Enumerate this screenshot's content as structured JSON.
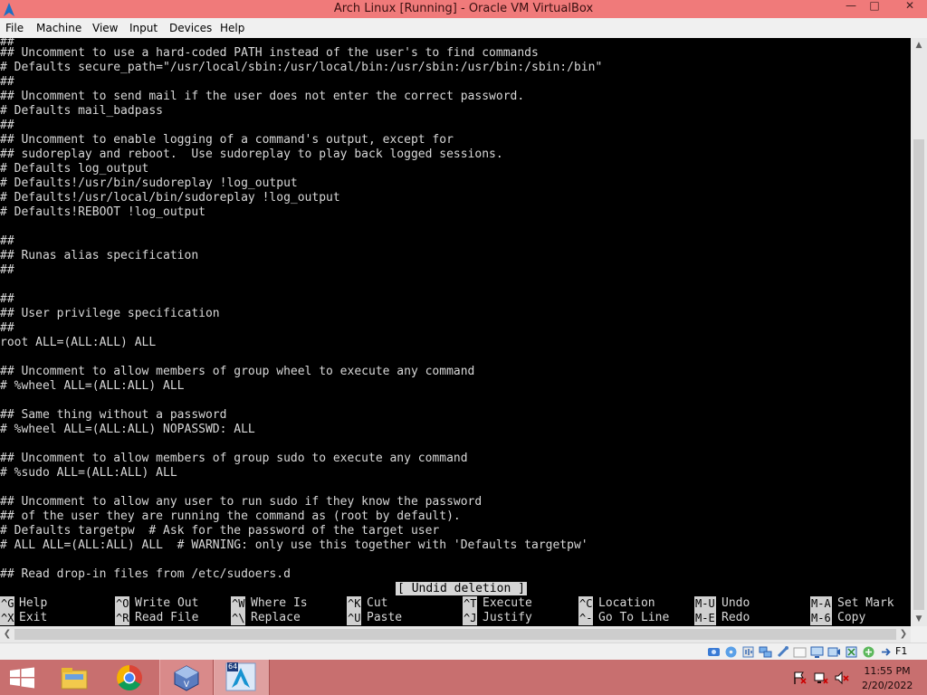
{
  "window": {
    "title": "Arch Linux [Running] - Oracle VM VirtualBox"
  },
  "menu": [
    "File",
    "Machine",
    "View",
    "Input",
    "Devices",
    "Help"
  ],
  "terminal": {
    "lines": [
      "##",
      "## Uncomment to use a hard-coded PATH instead of the user's to find commands",
      "# Defaults secure_path=\"/usr/local/sbin:/usr/local/bin:/usr/sbin:/usr/bin:/sbin:/bin\"",
      "##",
      "## Uncomment to send mail if the user does not enter the correct password.",
      "# Defaults mail_badpass",
      "##",
      "## Uncomment to enable logging of a command's output, except for",
      "## sudoreplay and reboot.  Use sudoreplay to play back logged sessions.",
      "# Defaults log_output",
      "# Defaults!/usr/bin/sudoreplay !log_output",
      "# Defaults!/usr/local/bin/sudoreplay !log_output",
      "# Defaults!REBOOT !log_output",
      "",
      "##",
      "## Runas alias specification",
      "##",
      "",
      "##",
      "## User privilege specification",
      "##",
      "root ALL=(ALL:ALL) ALL",
      "",
      "## Uncomment to allow members of group wheel to execute any command",
      "# %wheel ALL=(ALL:ALL) ALL",
      "",
      "## Same thing without a password",
      "# %wheel ALL=(ALL:ALL) NOPASSWD: ALL",
      "",
      "## Uncomment to allow members of group sudo to execute any command",
      "# %sudo ALL=(ALL:ALL) ALL",
      "",
      "## Uncomment to allow any user to run sudo if they know the password",
      "## of the user they are running the command as (root by default).",
      "# Defaults targetpw  # Ask for the password of the target user",
      "# ALL ALL=(ALL:ALL) ALL  # WARNING: only use this together with 'Defaults targetpw'",
      "",
      "## Read drop-in files from /etc/sudoers.d"
    ],
    "status_message": "[ Undid deletion ]",
    "shortcuts_row1": [
      {
        "key": "^G",
        "label": "Help"
      },
      {
        "key": "^O",
        "label": "Write Out"
      },
      {
        "key": "^W",
        "label": "Where Is"
      },
      {
        "key": "^K",
        "label": "Cut"
      },
      {
        "key": "^T",
        "label": "Execute"
      },
      {
        "key": "^C",
        "label": "Location"
      },
      {
        "key": "M-U",
        "label": "Undo"
      },
      {
        "key": "M-A",
        "label": "Set Mark"
      }
    ],
    "shortcuts_row2": [
      {
        "key": "^X",
        "label": "Exit"
      },
      {
        "key": "^R",
        "label": "Read File"
      },
      {
        "key": "^\\",
        "label": "Replace"
      },
      {
        "key": "^U",
        "label": "Paste"
      },
      {
        "key": "^J",
        "label": "Justify"
      },
      {
        "key": "^-",
        "label": "Go To Line"
      },
      {
        "key": "M-E",
        "label": "Redo"
      },
      {
        "key": "M-6",
        "label": "Copy"
      }
    ]
  },
  "vm_status": {
    "host_key": "F1",
    "icons": [
      "hard-disk-icon",
      "optical-drive-icon",
      "audio-icon",
      "network-icon",
      "usb-icon",
      "shared-folders-icon",
      "display-icon",
      "recording-icon",
      "cpu-icon",
      "mouse-integration-icon",
      "host-key-arrow-icon"
    ]
  },
  "taskbar": {
    "clock_time": "11:55 PM",
    "clock_date": "2/20/2022",
    "pinned": [
      "start-button",
      "file-explorer-icon",
      "chrome-icon",
      "virtualbox-icon",
      "arch-linux-vm-icon"
    ],
    "arch_badge": "64",
    "tray": [
      "action-center-flag-icon",
      "network-tray-icon",
      "volume-muted-icon"
    ]
  },
  "colors": {
    "titlebar": "#f07a7a",
    "taskbar": "#c86f6f",
    "terminal_bg": "#000000",
    "terminal_fg": "#d8d8d8"
  }
}
